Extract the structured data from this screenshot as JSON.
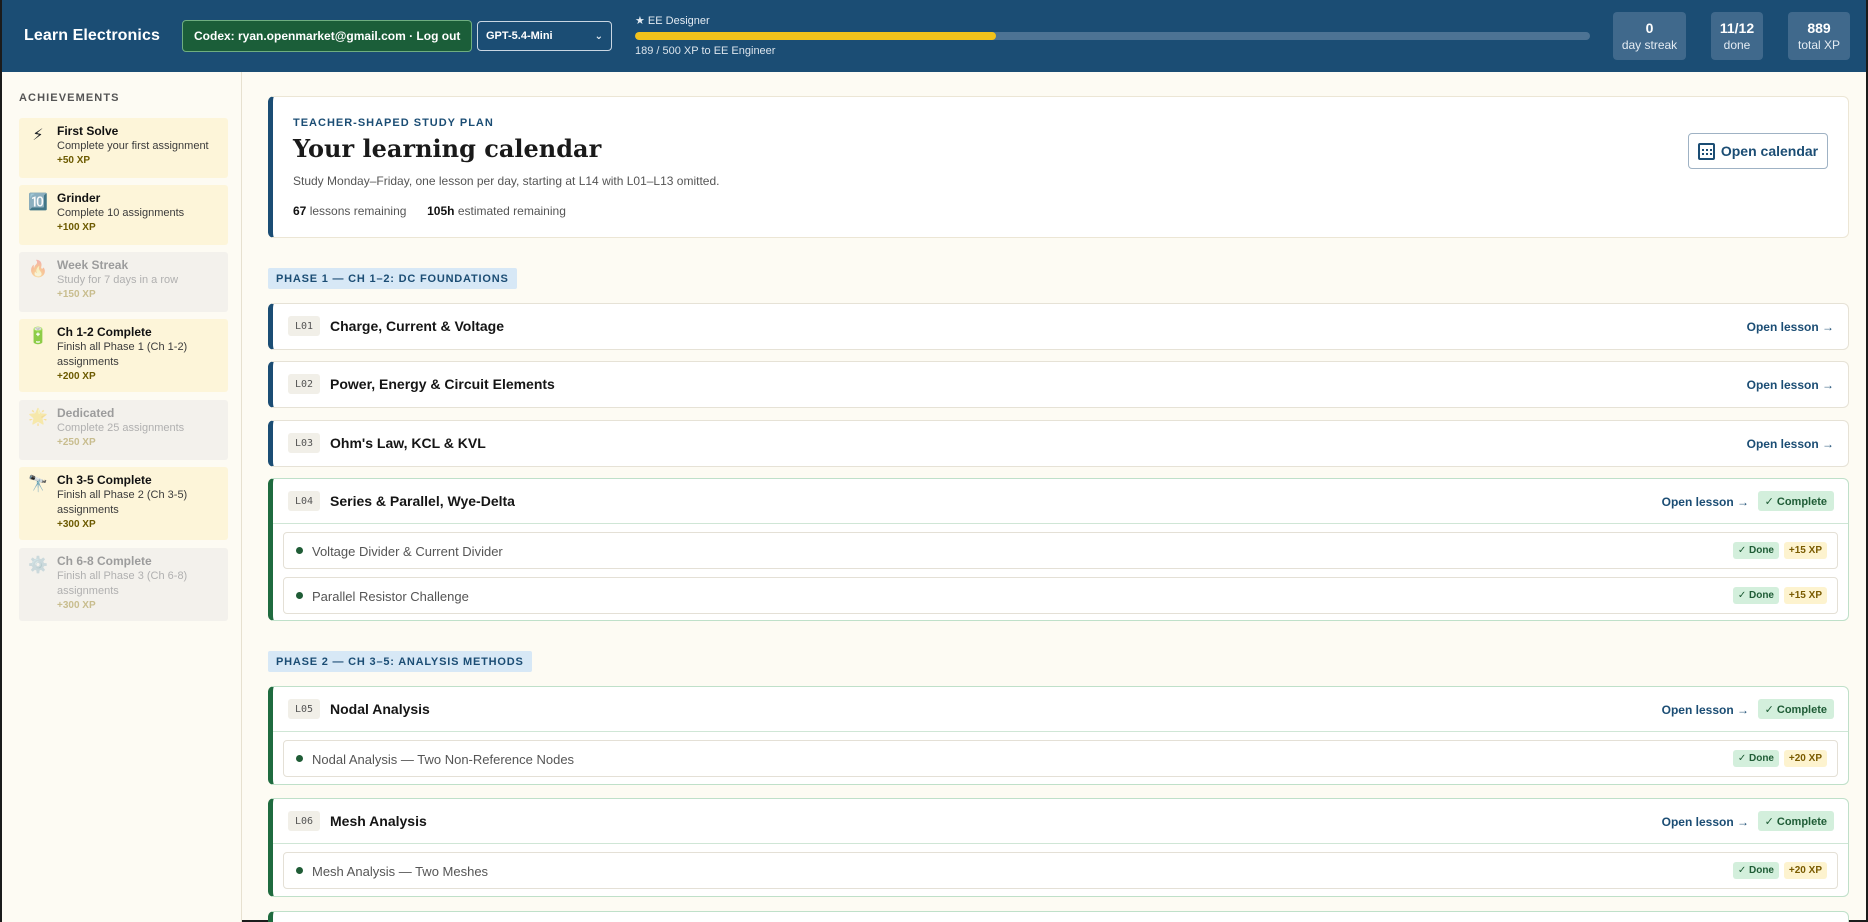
{
  "header": {
    "brand": "Learn Electronics",
    "account_button": "Codex: ryan.openmarket@gmail.com · Log out",
    "model": {
      "selected": "GPT-5.4-Mini"
    },
    "rank": {
      "label": "★ EE Designer",
      "progress_fraction": 0.378,
      "caption": "189 / 500 XP to EE Engineer"
    },
    "stats": [
      {
        "value": "0",
        "label": "day streak"
      },
      {
        "value": "11/12",
        "label": "done"
      },
      {
        "value": "889",
        "label": "total XP"
      }
    ]
  },
  "sidebar": {
    "title": "ACHIEVEMENTS",
    "achievements": [
      {
        "icon": "⚡",
        "icon_name": "lightning-icon",
        "name": "First Solve",
        "desc": "Complete your first assignment",
        "xp": "+50 XP",
        "locked": false
      },
      {
        "icon": "🔟",
        "icon_name": "ten-icon",
        "name": "Grinder",
        "desc": "Complete 10 assignments",
        "xp": "+100 XP",
        "locked": false
      },
      {
        "icon": "🔥",
        "icon_name": "fire-icon",
        "name": "Week Streak",
        "desc": "Study for 7 days in a row",
        "xp": "+150 XP",
        "locked": true
      },
      {
        "icon": "🔋",
        "icon_name": "battery-icon",
        "name": "Ch 1-2 Complete",
        "desc": "Finish all Phase 1 (Ch 1-2) assignments",
        "xp": "+200 XP",
        "locked": false
      },
      {
        "icon": "🌟",
        "icon_name": "star-icon",
        "name": "Dedicated",
        "desc": "Complete 25 assignments",
        "xp": "+250 XP",
        "locked": true
      },
      {
        "icon": "🔭",
        "icon_name": "telescope-icon",
        "name": "Ch 3-5 Complete",
        "desc": "Finish all Phase 2 (Ch 3-5) assignments",
        "xp": "+300 XP",
        "locked": false
      },
      {
        "icon": "⚙️",
        "icon_name": "gear-icon",
        "name": "Ch 6-8 Complete",
        "desc": "Finish all Phase 3 (Ch 6-8) assignments",
        "xp": "+300 XP",
        "locked": true
      }
    ]
  },
  "plan": {
    "kicker": "TEACHER-SHAPED STUDY PLAN",
    "title": "Your learning calendar",
    "subtitle": "Study Monday–Friday, one lesson per day, starting at L14 with L01–L13 omitted.",
    "lessons_remaining_value": "67",
    "lessons_remaining_label": "lessons remaining",
    "hours_remaining_value": "105h",
    "hours_remaining_label": "estimated remaining",
    "calendar_button": "Open calendar"
  },
  "phases": [
    {
      "label": "PHASE 1 — CH 1–2: DC FOUNDATIONS"
    },
    {
      "label": "PHASE 2 — CH 3–5: ANALYSIS METHODS"
    }
  ],
  "lessons": [
    {
      "code": "L01",
      "title": "Charge, Current & Voltage",
      "open": "Open lesson →"
    },
    {
      "code": "L02",
      "title": "Power, Energy & Circuit Elements",
      "open": "Open lesson →"
    },
    {
      "code": "L03",
      "title": "Ohm's Law, KCL & KVL",
      "open": "Open lesson →"
    },
    {
      "code": "L04",
      "title": "Series & Parallel, Wye-Delta",
      "open": "Open lesson →",
      "badge": "✓ Complete",
      "tasks": [
        {
          "name": "Voltage Divider & Current Divider",
          "done": "✓ Done",
          "xp": "+15 XP"
        },
        {
          "name": "Parallel Resistor Challenge",
          "done": "✓ Done",
          "xp": "+15 XP"
        }
      ]
    },
    {
      "code": "L05",
      "title": "Nodal Analysis",
      "open": "Open lesson →",
      "badge": "✓ Complete",
      "tasks": [
        {
          "name": "Nodal Analysis — Two Non-Reference Nodes",
          "done": "✓ Done",
          "xp": "+20 XP"
        }
      ]
    },
    {
      "code": "L06",
      "title": "Mesh Analysis",
      "open": "Open lesson →",
      "badge": "✓ Complete",
      "tasks": [
        {
          "name": "Mesh Analysis — Two Meshes",
          "done": "✓ Done",
          "xp": "+20 XP"
        }
      ]
    }
  ],
  "colors": {
    "header": "#1b4d74",
    "accent_gold": "#f2c21b",
    "complete_green": "#1f6b3f",
    "page_bg": "#fdfbf3"
  }
}
